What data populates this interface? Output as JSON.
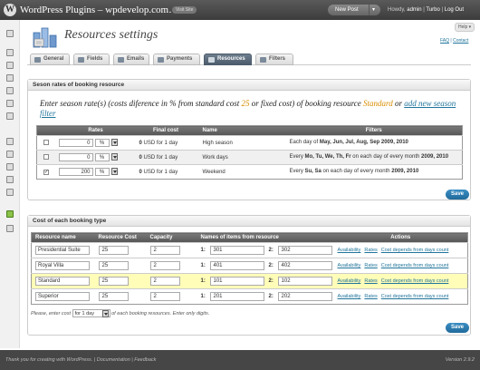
{
  "topbar": {
    "site_title": "WordPress Plugins – wpdevelop.com…",
    "visit_site": "Visit Site",
    "new_post": "New Post",
    "howdy": "Howdy,",
    "user": "admin",
    "turbo": "Turbo",
    "logout": "Log Out"
  },
  "help": "Help ▾",
  "header": {
    "title": "Resources settings",
    "faq": "FAQ",
    "contact": "Contact"
  },
  "tabs": [
    {
      "label": "General"
    },
    {
      "label": "Fields"
    },
    {
      "label": "Emails"
    },
    {
      "label": "Payments"
    },
    {
      "label": "Resources"
    },
    {
      "label": "Filters"
    }
  ],
  "seasons": {
    "heading": "Seson rates of booking resource",
    "intro_1": "Enter season rate(s) (costs diference in % from standard cost",
    "base_cost": "25",
    "intro_2": "or fixed cost) of booking resource",
    "resource": "Standard",
    "intro_3": "or",
    "add_link": "add new season filter",
    "columns": [
      "",
      "Rates",
      "Final cost",
      "Name",
      "Filters"
    ],
    "rows": [
      {
        "checked": "",
        "rate": "0",
        "unit": "%",
        "cost": "0",
        "cost_suffix": "USD for 1 day",
        "name": "High season",
        "filter_pre": "Each day of",
        "filter_bold": "May, Jun, Jul, Aug, Sep 2009, 2010",
        "filter_mid": "",
        "filter_bold2": ""
      },
      {
        "checked": "",
        "rate": "0",
        "unit": "%",
        "cost": "0",
        "cost_suffix": "USD for 1 day",
        "name": "Work days",
        "filter_pre": "Every",
        "filter_bold": "Mo, Tu, We, Th, Fr",
        "filter_mid": "on each day of every month",
        "filter_bold2": "2009, 2010"
      },
      {
        "checked": "✓",
        "rate": "200",
        "unit": "%",
        "cost": "0",
        "cost_suffix": "USD for 1 day",
        "name": "Weekend",
        "filter_pre": "Every",
        "filter_bold": "Su, Sa",
        "filter_mid": "on each day of every month",
        "filter_bold2": "2009, 2010"
      }
    ],
    "save": "Save"
  },
  "costs": {
    "heading": "Cost of each booking type",
    "columns": [
      "Resource name",
      "Resource Cost",
      "Capacity",
      "Names of items from resource",
      "Actions"
    ],
    "rows": [
      {
        "name": "Presidential Suite",
        "cost": "25",
        "capacity": "2",
        "n1": "1:",
        "item1": "301",
        "n2": "2:",
        "item2": "302"
      },
      {
        "name": "Royal Villa",
        "cost": "25",
        "capacity": "2",
        "n1": "1:",
        "item1": "401",
        "n2": "2:",
        "item2": "402"
      },
      {
        "name": "Standard",
        "cost": "25",
        "capacity": "2",
        "n1": "1:",
        "item1": "101",
        "n2": "2:",
        "item2": "102"
      },
      {
        "name": "Superior",
        "cost": "25",
        "capacity": "2",
        "n1": "1:",
        "item1": "201",
        "n2": "2:",
        "item2": "202"
      }
    ],
    "actions": {
      "availability": "Availability",
      "rates": "Rates",
      "depends": "Cost depends from days count"
    },
    "note_pre": "Please, enter cost",
    "note_select": "for 1 day",
    "note_post": "of each booking resources. Enter only digits.",
    "save": "Save"
  },
  "footer": {
    "left": "Thank you for creating with WordPress. | Documentation | Feedback",
    "right": "Version 2.9.2"
  },
  "colors": {
    "accent": "#21759b",
    "orange": "#d98c00",
    "highlight": "#fffdb8"
  }
}
